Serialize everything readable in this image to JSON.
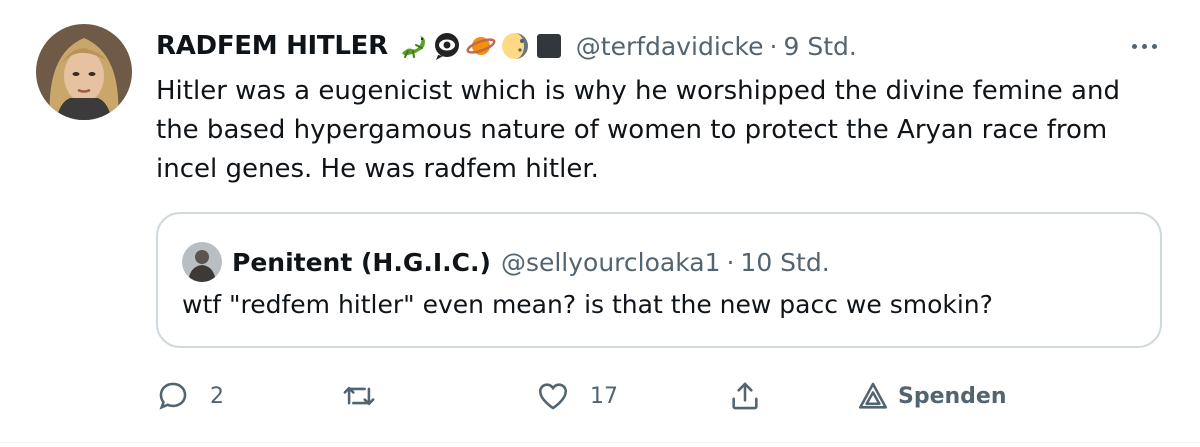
{
  "tweet": {
    "display_name": "RADFEM HITLER",
    "badges": [
      "lizard-emoji",
      "eye-in-speech-bubble-emoji",
      "ringed-planet-emoji",
      "moon-emoji",
      "black-square-emoji"
    ],
    "handle": "@terfdavidicke",
    "separator": "·",
    "time": "9 Std.",
    "text": "Hitler was a eugenicist which is why he worshipped the divine femine and the based hypergamous nature of women to protect the Aryan race from incel genes. He was radfem hitler."
  },
  "quoted_tweet": {
    "display_name": "Penitent (H.G.I.C.)",
    "handle": "@sellyourcloaka1",
    "separator": "·",
    "time": "10 Std.",
    "text": "wtf \"redfem hitler\" even mean? is that the new pacc we smokin?"
  },
  "actions": {
    "reply_count": "2",
    "retweet_count": "",
    "like_count": "17",
    "spenden_label": "Spenden"
  },
  "colors": {
    "text_primary": "#0f1419",
    "text_secondary": "#536471",
    "border": "#cfd9de"
  }
}
